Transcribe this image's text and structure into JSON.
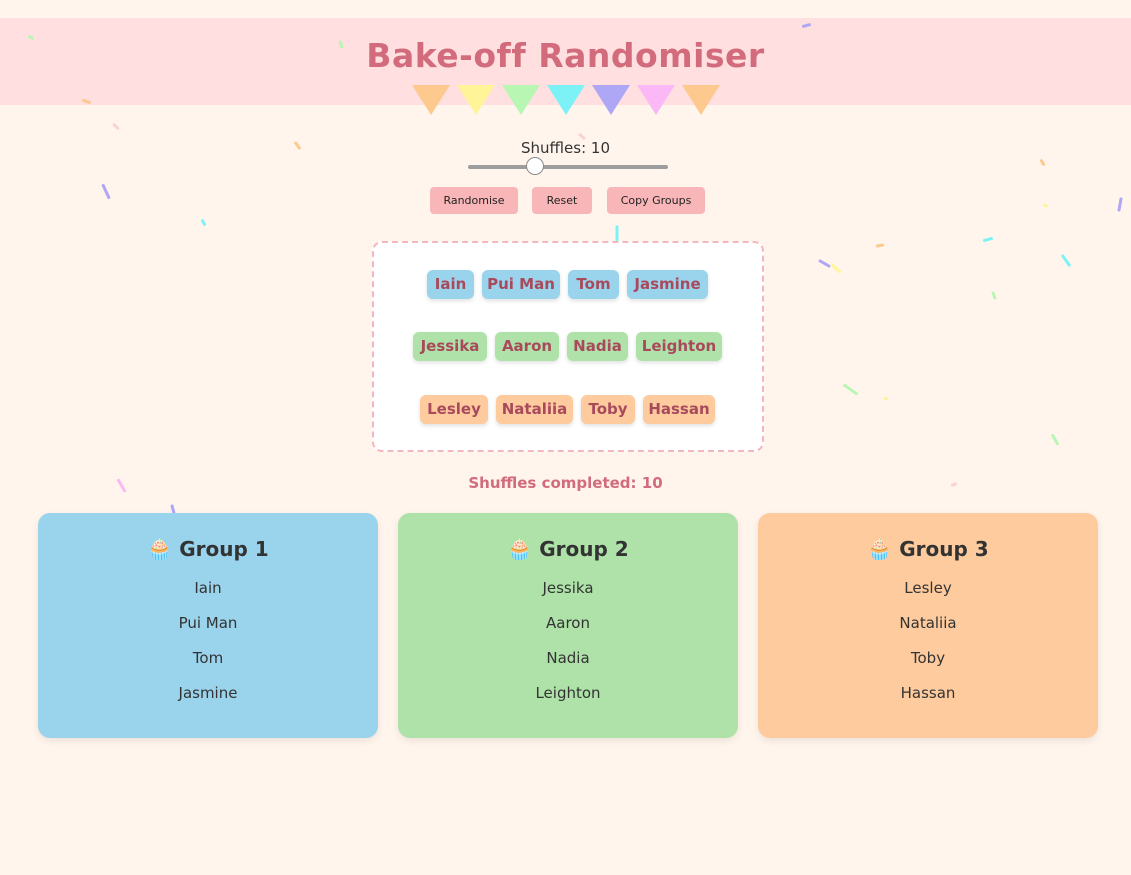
{
  "app": {
    "title": "Bake-off Randomiser"
  },
  "colors": {
    "background": "#fff5ec",
    "header_band": "#ffdfe0",
    "title": "#d26c7c",
    "button": "#f8b6b8",
    "group_1": "#9ad3ec",
    "group_2": "#aee2a8",
    "group_3": "#fdcb9d",
    "bunting": [
      "#fec98f",
      "#fff497",
      "#b8f6b4",
      "#7cf2f6",
      "#aea7f6",
      "#fbb8f6",
      "#fec98f"
    ]
  },
  "slider": {
    "label": "Shuffles: 10",
    "value": 10,
    "fraction": 0.32
  },
  "buttons": {
    "randomise": "Randomise",
    "reset": "Reset",
    "copy": "Copy Groups"
  },
  "pool": {
    "rows": [
      [
        "Iain",
        "Pui Man",
        "Tom",
        "Jasmine"
      ],
      [
        "Jessika",
        "Aaron",
        "Nadia",
        "Leighton"
      ],
      [
        "Lesley",
        "Nataliia",
        "Toby",
        "Hassan"
      ]
    ]
  },
  "status": {
    "shuffles_completed": "Shuffles completed: 10"
  },
  "groups": [
    {
      "icon": "🧁",
      "title": "Group 1",
      "members": [
        "Iain",
        "Pui Man",
        "Tom",
        "Jasmine"
      ]
    },
    {
      "icon": "🧁",
      "title": "Group 2",
      "members": [
        "Jessika",
        "Aaron",
        "Nadia",
        "Leighton"
      ]
    },
    {
      "icon": "🧁",
      "title": "Group 3",
      "members": [
        "Lesley",
        "Nataliia",
        "Toby",
        "Hassan"
      ]
    }
  ]
}
